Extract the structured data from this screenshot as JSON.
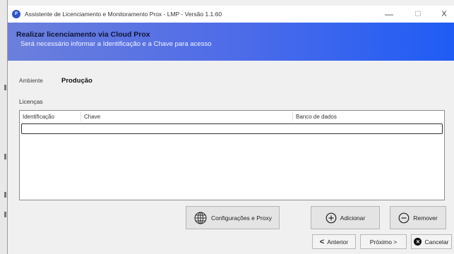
{
  "window": {
    "title": "Assistente de Licenciamento e Monitoramento Prox - LMP - Versão 1.1.60",
    "minimize_glyph": "—",
    "maximize_glyph": "☐",
    "close_glyph": "X",
    "app_icon": "prox-logo-icon"
  },
  "banner": {
    "title": "Realizar licenciamento via Cloud Prox",
    "subtitle": "Será necessário informar a Identificação e a Chave para acesso",
    "gradient_colors": [
      "#6b7fdc",
      "#1f5cf5"
    ]
  },
  "form": {
    "ambiente_label": "Ambiente",
    "ambiente_value": "Produção",
    "licencas_label": "Licenças"
  },
  "grid": {
    "columns": [
      "Identificação",
      "Chave",
      "Banco de dados"
    ],
    "rows": []
  },
  "actions": {
    "config_proxy": {
      "label": "Configurações e Proxy",
      "icon": "globe-grid-icon"
    },
    "adicionar": {
      "label": "Adicionar",
      "icon": "plus-circle-icon"
    },
    "remover": {
      "label": "Remover",
      "icon": "minus-circle-icon"
    }
  },
  "navigation": {
    "anterior": {
      "label": "Anterior",
      "arrow": "<"
    },
    "proximo": {
      "label": "Próximo >",
      "arrow": ">"
    },
    "cancelar": {
      "label": "Cancelar",
      "icon_glyph": "✕"
    }
  }
}
